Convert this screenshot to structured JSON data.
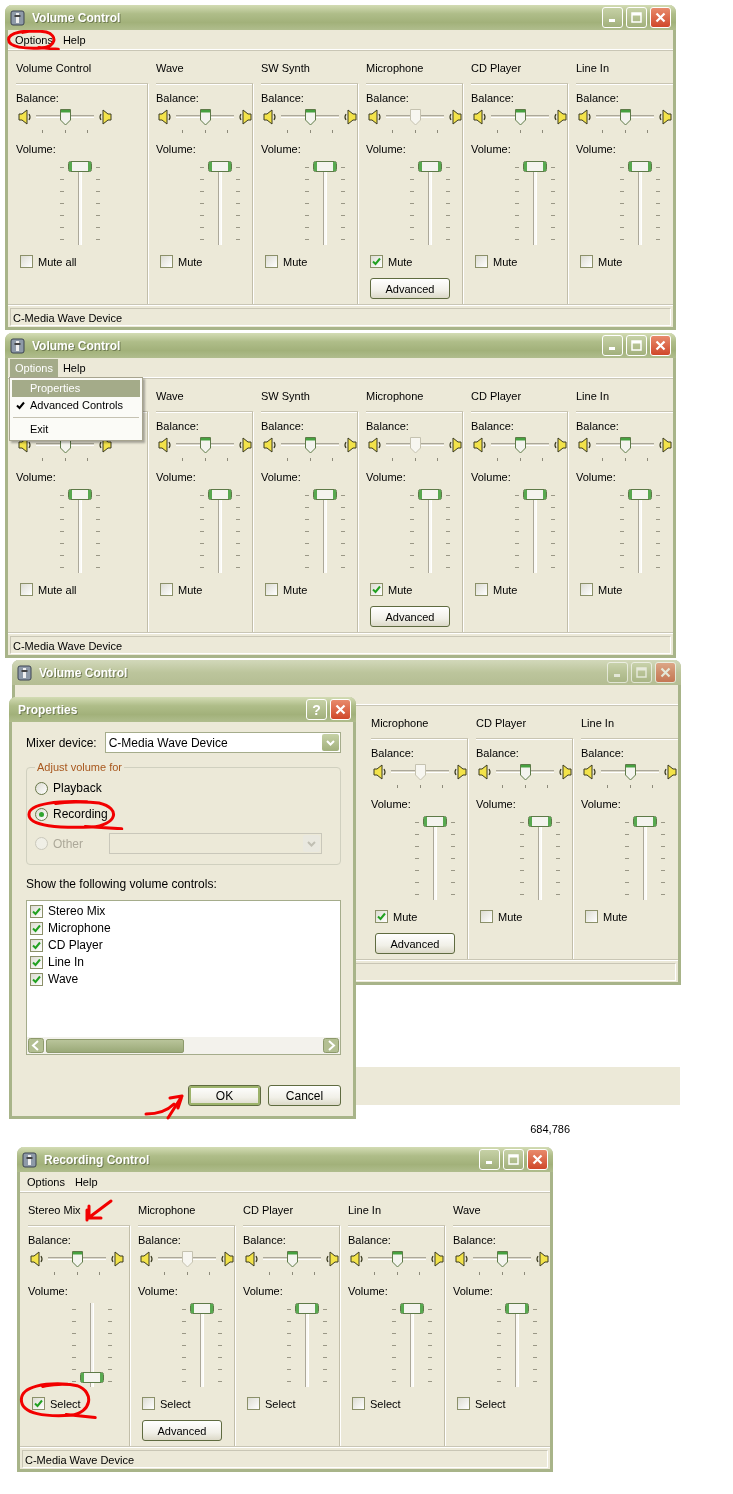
{
  "screens": [
    {
      "kind": "mixer",
      "window": {
        "title": "Volume Control",
        "active": true
      },
      "menu": [
        {
          "label": "Options",
          "selected": false,
          "circled": true
        },
        {
          "label": "Help",
          "selected": false
        }
      ],
      "channels": [
        {
          "kind": "master",
          "name": "Volume Control",
          "balance_label": "Balance:",
          "balance": {
            "level": 0.5,
            "disabled": false
          },
          "volume_label": "Volume:",
          "volume": {
            "level": 1
          },
          "checkbox": {
            "label": "Mute all",
            "checked": false
          }
        },
        {
          "kind": "line",
          "name": "Wave",
          "balance_label": "Balance:",
          "balance": {
            "level": 0.5,
            "disabled": false
          },
          "volume_label": "Volume:",
          "volume": {
            "level": 1
          },
          "checkbox": {
            "label": "Mute",
            "checked": false
          }
        },
        {
          "kind": "line",
          "name": "SW Synth",
          "balance_label": "Balance:",
          "balance": {
            "level": 0.5,
            "disabled": false
          },
          "volume_label": "Volume:",
          "volume": {
            "level": 1
          },
          "checkbox": {
            "label": "Mute",
            "checked": false
          }
        },
        {
          "kind": "line",
          "name": "Microphone",
          "balance_label": "Balance:",
          "balance": {
            "level": 0.5,
            "disabled": true
          },
          "volume_label": "Volume:",
          "volume": {
            "level": 1
          },
          "checkbox": {
            "label": "Mute",
            "checked": true
          },
          "advanced": "Advanced"
        },
        {
          "kind": "line",
          "name": "CD Player",
          "balance_label": "Balance:",
          "balance": {
            "level": 0.5,
            "disabled": false
          },
          "volume_label": "Volume:",
          "volume": {
            "level": 1
          },
          "checkbox": {
            "label": "Mute",
            "checked": false
          }
        },
        {
          "kind": "line",
          "name": "Line In",
          "balance_label": "Balance:",
          "balance": {
            "level": 0.5,
            "disabled": false
          },
          "volume_label": "Volume:",
          "volume": {
            "level": 1
          },
          "checkbox": {
            "label": "Mute",
            "checked": false
          }
        }
      ],
      "status_bar": "C-Media Wave Device"
    },
    {
      "kind": "mixer",
      "window": {
        "title": "Volume Control",
        "active": true
      },
      "menu": [
        {
          "label": "Options",
          "selected": true,
          "items": [
            {
              "label": "Properties",
              "selected": true,
              "checked": false,
              "separator_before": false
            },
            {
              "label": "Advanced Controls",
              "selected": false,
              "checked": true,
              "separator_before": false
            },
            {
              "label": "Exit",
              "selected": false,
              "checked": false,
              "separator_before": true
            }
          ]
        },
        {
          "label": "Help",
          "selected": false
        }
      ],
      "channels": [
        {
          "kind": "master",
          "balance": {
            "level": 0.5,
            "disabled": false
          },
          "volume_label": "Volume:",
          "volume": {
            "level": 1
          },
          "checkbox": {
            "label": "Mute all",
            "checked": false
          }
        },
        {
          "kind": "line",
          "name": "Wave",
          "balance_label": "Balance:",
          "balance": {
            "level": 0.5,
            "disabled": false
          },
          "volume_label": "Volume:",
          "volume": {
            "level": 1
          },
          "checkbox": {
            "label": "Mute",
            "checked": false
          }
        },
        {
          "kind": "line",
          "name": "SW Synth",
          "balance_label": "Balance:",
          "balance": {
            "level": 0.5,
            "disabled": false
          },
          "volume_label": "Volume:",
          "volume": {
            "level": 1
          },
          "checkbox": {
            "label": "Mute",
            "checked": false
          }
        },
        {
          "kind": "line",
          "name": "Microphone",
          "balance_label": "Balance:",
          "balance": {
            "level": 0.5,
            "disabled": true
          },
          "volume_label": "Volume:",
          "volume": {
            "level": 1
          },
          "checkbox": {
            "label": "Mute",
            "checked": true
          },
          "advanced": "Advanced"
        },
        {
          "kind": "line",
          "name": "CD Player",
          "balance_label": "Balance:",
          "balance": {
            "level": 0.5,
            "disabled": false
          },
          "volume_label": "Volume:",
          "volume": {
            "level": 1
          },
          "checkbox": {
            "label": "Mute",
            "checked": false
          }
        },
        {
          "kind": "line",
          "name": "Line In",
          "balance_label": "Balance:",
          "balance": {
            "level": 0.5,
            "disabled": false
          },
          "volume_label": "Volume:",
          "volume": {
            "level": 1
          },
          "checkbox": {
            "label": "Mute",
            "checked": false
          }
        }
      ],
      "status_bar": "C-Media Wave Device"
    },
    {
      "kind": "properties",
      "window": {
        "title": "Volume Control",
        "active": false
      },
      "channels": [
        {
          "kind": "line",
          "name": "Microphone",
          "balance_label": "Balance:",
          "balance": {
            "level": 0.5,
            "disabled": true
          },
          "volume_label": "Volume:",
          "volume": {
            "level": 1
          },
          "checkbox": {
            "label": "Mute",
            "checked": true
          },
          "advanced": "Advanced"
        },
        {
          "kind": "line",
          "name": "CD Player",
          "balance_label": "Balance:",
          "balance": {
            "level": 0.5,
            "disabled": false
          },
          "volume_label": "Volume:",
          "volume": {
            "level": 1
          },
          "checkbox": {
            "label": "Mute",
            "checked": false
          }
        },
        {
          "kind": "line",
          "name": "Line In",
          "balance_label": "Balance:",
          "balance": {
            "level": 0.5,
            "disabled": false
          },
          "volume_label": "Volume:",
          "volume": {
            "level": 1
          },
          "checkbox": {
            "label": "Mute",
            "checked": false
          }
        }
      ],
      "dialog": {
        "title": "Properties",
        "help_button": "?",
        "mixer_label": "Mixer device:",
        "mixer_value": "C-Media Wave Device",
        "group_label": "Adjust volume for",
        "options": [
          {
            "label": "Playback",
            "selected": false,
            "disabled": false
          },
          {
            "label": "Recording",
            "selected": true,
            "disabled": false,
            "circled": true
          },
          {
            "label": "Other",
            "selected": false,
            "disabled": true
          }
        ],
        "list_label": "Show the following volume controls:",
        "list": [
          {
            "label": "Stereo Mix",
            "checked": true
          },
          {
            "label": "Microphone",
            "checked": true
          },
          {
            "label": "CD Player",
            "checked": true
          },
          {
            "label": "Line In",
            "checked": true
          },
          {
            "label": "Wave",
            "checked": true
          }
        ],
        "buttons": [
          {
            "label": "OK",
            "default": true,
            "arrowed": true
          },
          {
            "label": "Cancel",
            "default": false
          }
        ]
      },
      "backdrop_text": "684,786"
    },
    {
      "kind": "mixer",
      "window": {
        "title": "Recording Control",
        "active": true
      },
      "menu": [
        {
          "label": "Options",
          "selected": false
        },
        {
          "label": "Help",
          "selected": false
        }
      ],
      "channels": [
        {
          "kind": "line",
          "name": "Stereo Mix",
          "name_arrowed": true,
          "balance_label": "Balance:",
          "balance": {
            "level": 0.5,
            "disabled": false
          },
          "volume_label": "Volume:",
          "volume": {
            "level": 0.05
          },
          "checkbox": {
            "label": "Select",
            "checked": true,
            "circled": true
          }
        },
        {
          "kind": "line",
          "name": "Microphone",
          "balance_label": "Balance:",
          "balance": {
            "level": 0.5,
            "disabled": true
          },
          "volume_label": "Volume:",
          "volume": {
            "level": 1
          },
          "checkbox": {
            "label": "Select",
            "checked": false
          },
          "advanced": "Advanced"
        },
        {
          "kind": "line",
          "name": "CD Player",
          "balance_label": "Balance:",
          "balance": {
            "level": 0.5,
            "disabled": false
          },
          "volume_label": "Volume:",
          "volume": {
            "level": 1
          },
          "checkbox": {
            "label": "Select",
            "checked": false
          }
        },
        {
          "kind": "line",
          "name": "Line In",
          "balance_label": "Balance:",
          "balance": {
            "level": 0.5,
            "disabled": false
          },
          "volume_label": "Volume:",
          "volume": {
            "level": 1
          },
          "checkbox": {
            "label": "Select",
            "checked": false
          }
        },
        {
          "kind": "line",
          "name": "Wave",
          "balance_label": "Balance:",
          "balance": {
            "level": 0.5,
            "disabled": false
          },
          "volume_label": "Volume:",
          "volume": {
            "level": 1
          },
          "checkbox": {
            "label": "Select",
            "checked": false
          }
        }
      ],
      "status_bar": "C-Media Wave Device"
    }
  ]
}
